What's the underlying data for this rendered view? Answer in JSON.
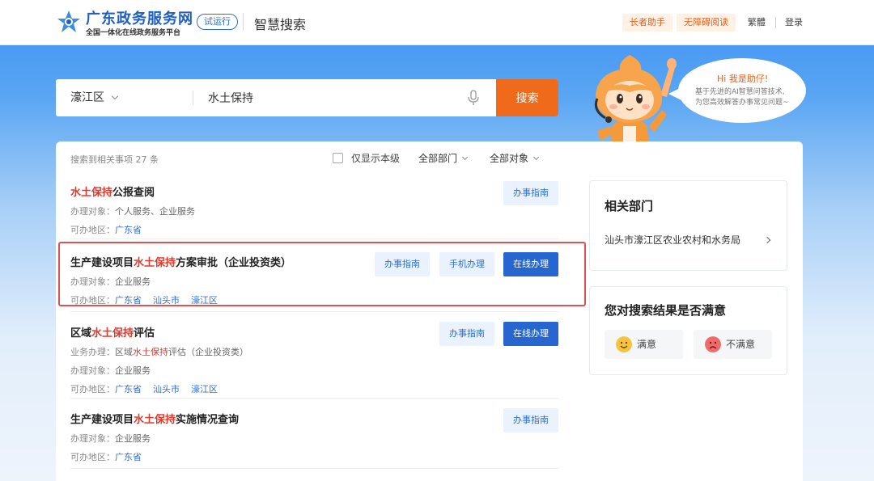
{
  "header": {
    "brand_title": "广东政务服务网",
    "brand_subtitle": "全国一体化在线政务服务平台",
    "trial_badge": "试运行",
    "section_name": "智慧搜索",
    "elder_assist": "长者助手",
    "accessible_reading": "无障碍阅读",
    "traditional": "繁體",
    "login": "登录"
  },
  "search": {
    "region": "濠江区",
    "query": "水土保持",
    "button": "搜索"
  },
  "filters": {
    "result_count": "搜索到相关事项 27 条",
    "local_only": "仅显示本级",
    "all_departments": "全部部门",
    "all_targets": "全部对象"
  },
  "results": [
    {
      "title_hl": "水土保持",
      "title_rest": "公报查阅",
      "target_label": "办理对象：",
      "target_value": "个人服务、企业服务",
      "area_label": "可办地区：",
      "areas": [
        "广东省"
      ],
      "guide": "办事指南"
    },
    {
      "title_pre": "生产建设项目",
      "title_hl": "水土保持",
      "title_rest": "方案审批（企业投资类）",
      "target_label": "办理对象：",
      "target_value": "企业服务",
      "area_label": "可办地区：",
      "areas": [
        "广东省",
        "汕头市",
        "濠江区"
      ],
      "guide": "办事指南",
      "mobile": "手机办理",
      "online": "在线办理"
    },
    {
      "title_pre": "区域",
      "title_hl": "水土保持",
      "title_rest": "评估",
      "business_label": "业务办理：",
      "business_pre": "区域",
      "business_hl": "水土保持",
      "business_rest": "评估（企业投资类）",
      "target_label": "办理对象：",
      "target_value": "企业服务",
      "area_label": "可办地区：",
      "areas": [
        "广东省",
        "汕头市",
        "濠江区"
      ],
      "guide": "办事指南",
      "online": "在线办理"
    },
    {
      "title_pre": "生产建设项目",
      "title_hl": "水土保持",
      "title_rest": "实施情况查询",
      "target_label": "办理对象：",
      "target_value": "企业服务",
      "area_label": "可办地区：",
      "areas": [
        "广东省"
      ],
      "guide": "办事指南"
    }
  ],
  "sidebar": {
    "dept_title": "相关部门",
    "dept_link": "汕头市濠江区农业农村和水务局",
    "satisfaction_title": "您对搜索结果是否满意",
    "satisfied": "满意",
    "unsatisfied": "不满意"
  },
  "assistant": {
    "greeting": "Hi 我是助仔!",
    "line1": "基于先进的AI智慧问答技术,",
    "line2": "为您高效解答办事常见问题~"
  },
  "colors": {
    "brand_blue": "#2866cf",
    "accent_orange": "#ef6a1a",
    "highlight_red": "#e03a2e"
  }
}
